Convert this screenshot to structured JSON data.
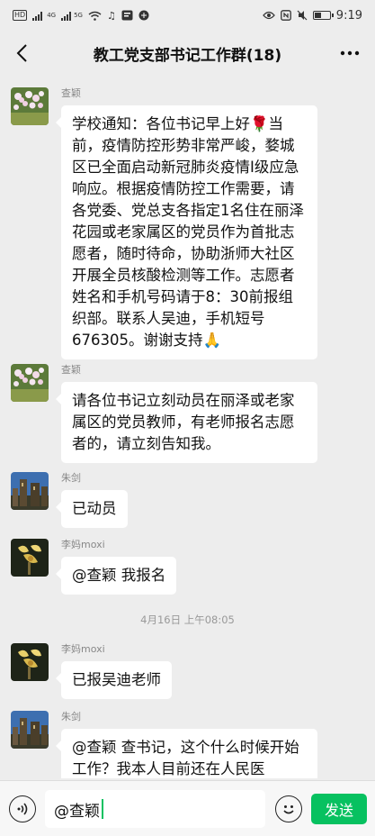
{
  "status_bar": {
    "left_icons": [
      "hd-icon",
      "signal-4g-icon",
      "signal-5g-icon",
      "wifi-icon",
      "music-icon",
      "notification-icon",
      "vpn-icon"
    ],
    "hd_label": "HD",
    "signal_label": "4G",
    "signal_label2": "5G",
    "time": "9:19",
    "right_icons": [
      "eye-icon",
      "nfc-icon",
      "mute-icon",
      "battery-icon"
    ],
    "battery_level": 0.4
  },
  "nav": {
    "title": "教工党支部书记工作群(18)"
  },
  "messages": [
    {
      "sender": "查颖",
      "text": "学校通知：各位书记早上好🌹当前，疫情防控形势非常严峻，婺城区已全面启动新冠肺炎疫情Ⅰ级应急响应。根据疫情防控工作需要，请各党委、党总支各指定1名住在丽泽花园或老家属区的党员作为首批志愿者，随时待命，协助浙师大社区开展全员核酸检测等工作。志愿者姓名和手机号码请于8：30前报组织部。联系人吴迪，手机短号676305。谢谢支持🙏"
    },
    {
      "sender": "查颖",
      "text": "请各位书记立刻动员在丽泽或老家属区的党员教师，有老师报名志愿者的，请立刻告知我。"
    },
    {
      "sender": "朱剑",
      "text": "已动员"
    },
    {
      "sender": "李妈moxi",
      "text": "@查颖  我报名"
    },
    {
      "sender": "李妈moxi",
      "text": "已报吴迪老师"
    },
    {
      "sender": "朱剑",
      "text": "@查颖  查书记，这个什么时候开始工作？我本人目前还在人民医"
    }
  ],
  "timestamp": "4月16日 上午08:05",
  "input": {
    "value": "@查颖",
    "send_label": "发送"
  },
  "colors": {
    "accent": "#07c160",
    "background": "#ededed",
    "bubble": "#ffffff"
  }
}
